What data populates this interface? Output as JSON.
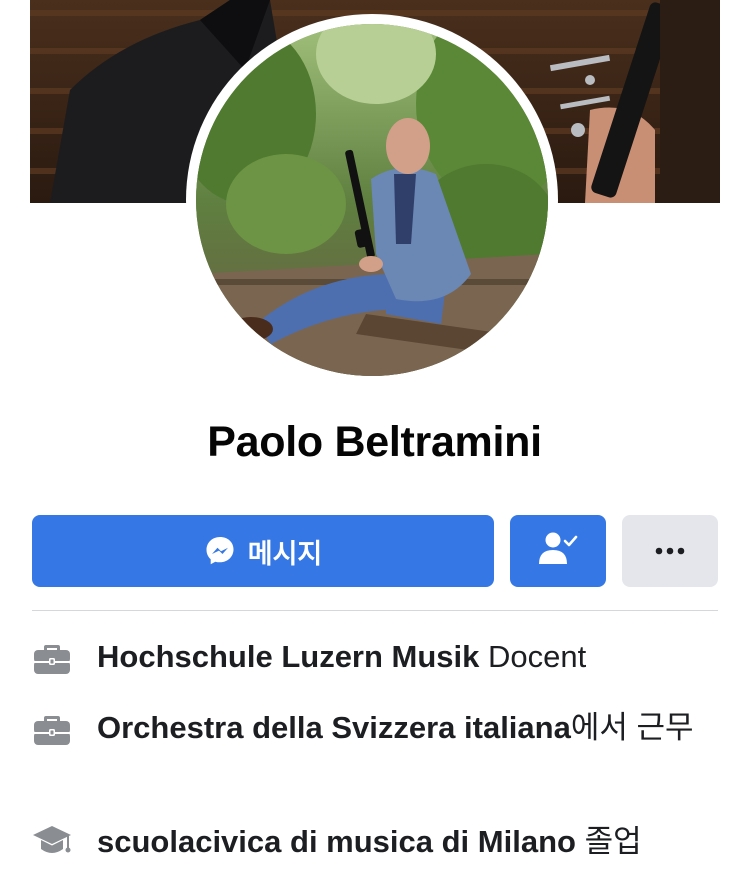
{
  "profile": {
    "name": "Paolo Beltramini"
  },
  "actions": {
    "message_label": "메시지"
  },
  "info": [
    {
      "icon": "briefcase-icon",
      "place": "Hochschule Luzern Musik",
      "detail": " Docent"
    },
    {
      "icon": "briefcase-icon",
      "place": "Orchestra della Svizzera italiana",
      "detail": "에서 근무"
    },
    {
      "icon": "graduation-cap-icon",
      "place": "scuolacivica di musica di Milano",
      "detail": " 졸업"
    }
  ],
  "colors": {
    "primary_button": "#3578e5",
    "secondary_button": "#e4e6eb",
    "icon_gray": "#8a8d91"
  }
}
